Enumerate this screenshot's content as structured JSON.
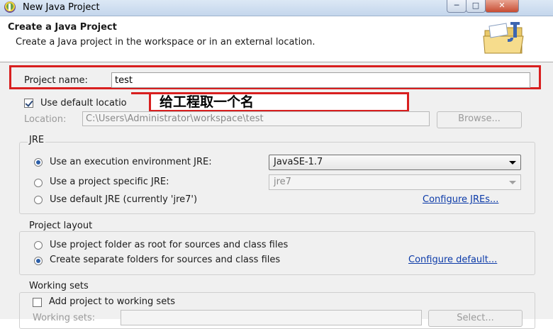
{
  "window": {
    "title": "New Java Project",
    "controls": [
      "─",
      "□",
      "✕"
    ]
  },
  "header": {
    "title": "Create a Java Project",
    "description": "Create a Java project in the workspace or in an external location."
  },
  "project_name": {
    "label": "Project name:",
    "value": "test"
  },
  "annotation": "给工程取一个名",
  "location": {
    "use_default_label": "Use default locatio",
    "use_default_checked": true,
    "label": "Location:",
    "value": "C:\\Users\\Administrator\\workspace\\test",
    "browse_label": "Browse..."
  },
  "jre": {
    "group_label": "JRE",
    "options": [
      {
        "label": "Use an execution environment JRE:",
        "selected": true
      },
      {
        "label": "Use a project specific JRE:",
        "selected": false
      },
      {
        "label": "Use default JRE (currently 'jre7')",
        "selected": false
      }
    ],
    "execution_environment": "JavaSE-1.7",
    "project_specific_jre": "jre7",
    "configure_link": "Configure JREs..."
  },
  "layout": {
    "group_label": "Project layout",
    "options": [
      {
        "label": "Use project folder as root for sources and class files",
        "selected": false
      },
      {
        "label": "Create separate folders for sources and class files",
        "selected": true
      }
    ],
    "configure_link": "Configure default..."
  },
  "working_sets": {
    "group_label": "Working sets",
    "add_label": "Add project to working sets",
    "add_checked": false,
    "field_label": "Working sets:",
    "select_button": "Select..."
  },
  "colors": {
    "highlight_red": "#d81f1f",
    "link_blue": "#0b3aa8",
    "dialog_bg": "#f0f0f0"
  }
}
